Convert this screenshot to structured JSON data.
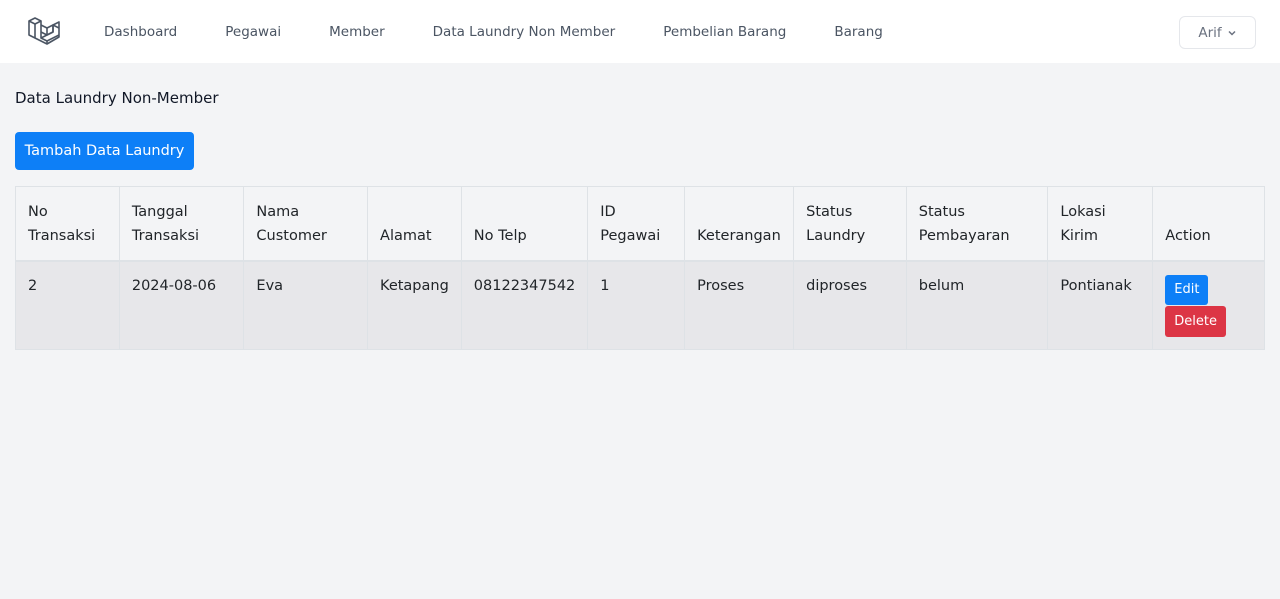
{
  "nav": {
    "logo_icon": "laravel-logo-icon",
    "links": [
      "Dashboard",
      "Pegawai",
      "Member",
      "Data Laundry Non Member",
      "Pembelian Barang",
      "Barang"
    ],
    "user_name": "Arif",
    "user_menu_icon": "chevron-down-icon"
  },
  "page": {
    "title": "Data Laundry Non-Member",
    "add_button": "Tambah Data Laundry"
  },
  "table": {
    "headers": [
      [
        "No",
        "Transaksi"
      ],
      [
        "Tanggal",
        "Transaksi"
      ],
      [
        "Nama",
        "Customer"
      ],
      [
        "Alamat"
      ],
      [
        "No Telp"
      ],
      [
        "ID",
        "Pegawai"
      ],
      [
        "Keterangan"
      ],
      [
        "Status",
        "Laundry"
      ],
      [
        "Status",
        "Pembayaran"
      ],
      [
        "Lokasi",
        "Kirim"
      ],
      [
        "Action"
      ]
    ],
    "rows": [
      {
        "cells": [
          "2",
          "2024-08-06",
          "Eva",
          "Ketapang",
          "08122347542",
          "1",
          "Proses",
          "diproses",
          "belum",
          "Pontianak"
        ],
        "edit_label": "Edit",
        "delete_label": "Delete"
      }
    ]
  },
  "colors": {
    "primary": "#0d7ff7",
    "danger": "#dc3545",
    "background": "#f3f4f6"
  }
}
